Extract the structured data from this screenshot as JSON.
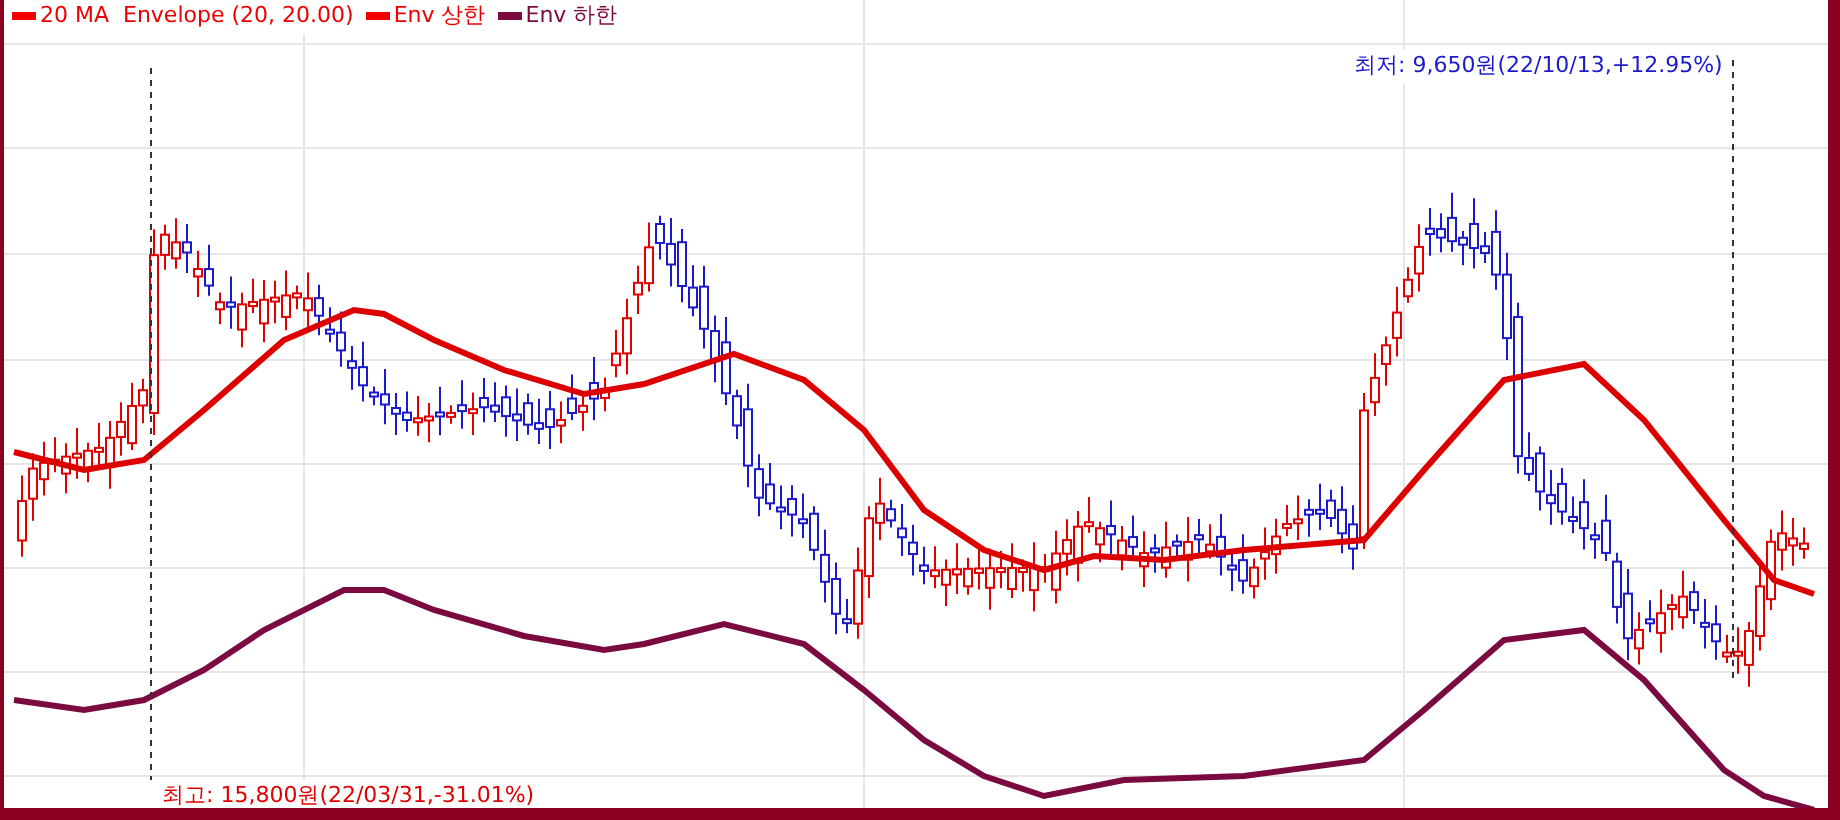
{
  "legend": [
    {
      "label": "20 MA  Envelope (20, 20.00)",
      "color": "#ee0000"
    },
    {
      "label": "Env 상한",
      "color": "#ee0000"
    },
    {
      "label": "Env 하한",
      "color": "#7a0a40"
    }
  ],
  "low_marker": {
    "text": "최저: 9,650원(22/10/13,+12.95%)"
  },
  "high_marker": {
    "text": "최고: 15,800원(22/03/31,-31.01%)"
  }
}
